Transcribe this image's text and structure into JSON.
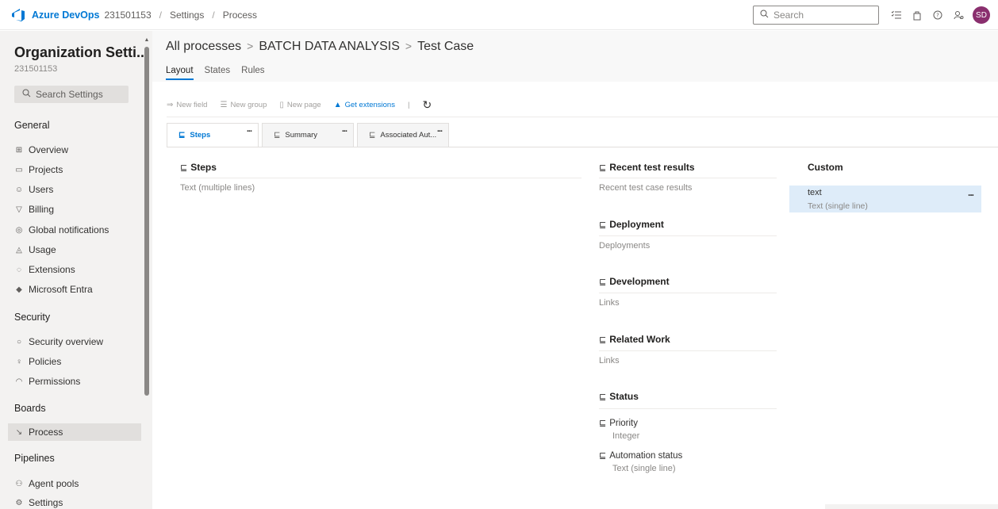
{
  "topbar": {
    "brand": "Azure DevOps",
    "org": "231501153",
    "sep": "/",
    "crumbs": [
      "Settings",
      "Process"
    ],
    "search_placeholder": "Search",
    "avatar": "SD"
  },
  "sidebar": {
    "title": "Organization Setti...",
    "subtitle": "231501153",
    "search_placeholder": "Search Settings",
    "sections": [
      {
        "heading": "General",
        "items": [
          {
            "label": "Overview",
            "icon": "overview-icon"
          },
          {
            "label": "Projects",
            "icon": "projects-icon"
          },
          {
            "label": "Users",
            "icon": "users-icon"
          },
          {
            "label": "Billing",
            "icon": "billing-icon"
          },
          {
            "label": "Global notifications",
            "icon": "notifications-icon"
          },
          {
            "label": "Usage",
            "icon": "usage-icon"
          },
          {
            "label": "Extensions",
            "icon": "extensions-icon"
          },
          {
            "label": "Microsoft Entra",
            "icon": "entra-icon"
          }
        ]
      },
      {
        "heading": "Security",
        "items": [
          {
            "label": "Security overview",
            "icon": "shield-icon"
          },
          {
            "label": "Policies",
            "icon": "policies-icon"
          },
          {
            "label": "Permissions",
            "icon": "lock-icon"
          }
        ]
      },
      {
        "heading": "Boards",
        "items": [
          {
            "label": "Process",
            "icon": "process-icon",
            "selected": true
          }
        ]
      },
      {
        "heading": "Pipelines",
        "items": [
          {
            "label": "Agent pools",
            "icon": "agent-pools-icon"
          },
          {
            "label": "Settings",
            "icon": "gear-icon"
          }
        ]
      }
    ]
  },
  "main": {
    "path": [
      "All processes",
      "BATCH DATA ANALYSIS",
      "Test Case"
    ],
    "path_sep": ">",
    "tabs": [
      "Layout",
      "States",
      "Rules"
    ],
    "toolbar": {
      "new_field": "New field",
      "new_group": "New group",
      "new_page": "New page",
      "get_extensions": "Get extensions",
      "sep": "|"
    },
    "page_tabs": [
      "Steps",
      "Summary",
      "Associated Aut..."
    ],
    "more": "...",
    "steps_group": {
      "title": "Steps",
      "field": "Text (multiple lines)"
    },
    "groups": [
      {
        "title": "Recent test results",
        "text": "Recent test case results"
      },
      {
        "title": "Deployment",
        "text": "Deployments"
      },
      {
        "title": "Development",
        "text": "Links"
      },
      {
        "title": "Related Work",
        "text": "Links"
      },
      {
        "title": "Status"
      }
    ],
    "status_fields": [
      {
        "name": "Priority",
        "type": "Integer"
      },
      {
        "name": "Automation status",
        "type": "Text (single line)"
      }
    ],
    "custom": {
      "title": "Custom",
      "field_name": "text",
      "field_type": "Text (single line)"
    }
  }
}
